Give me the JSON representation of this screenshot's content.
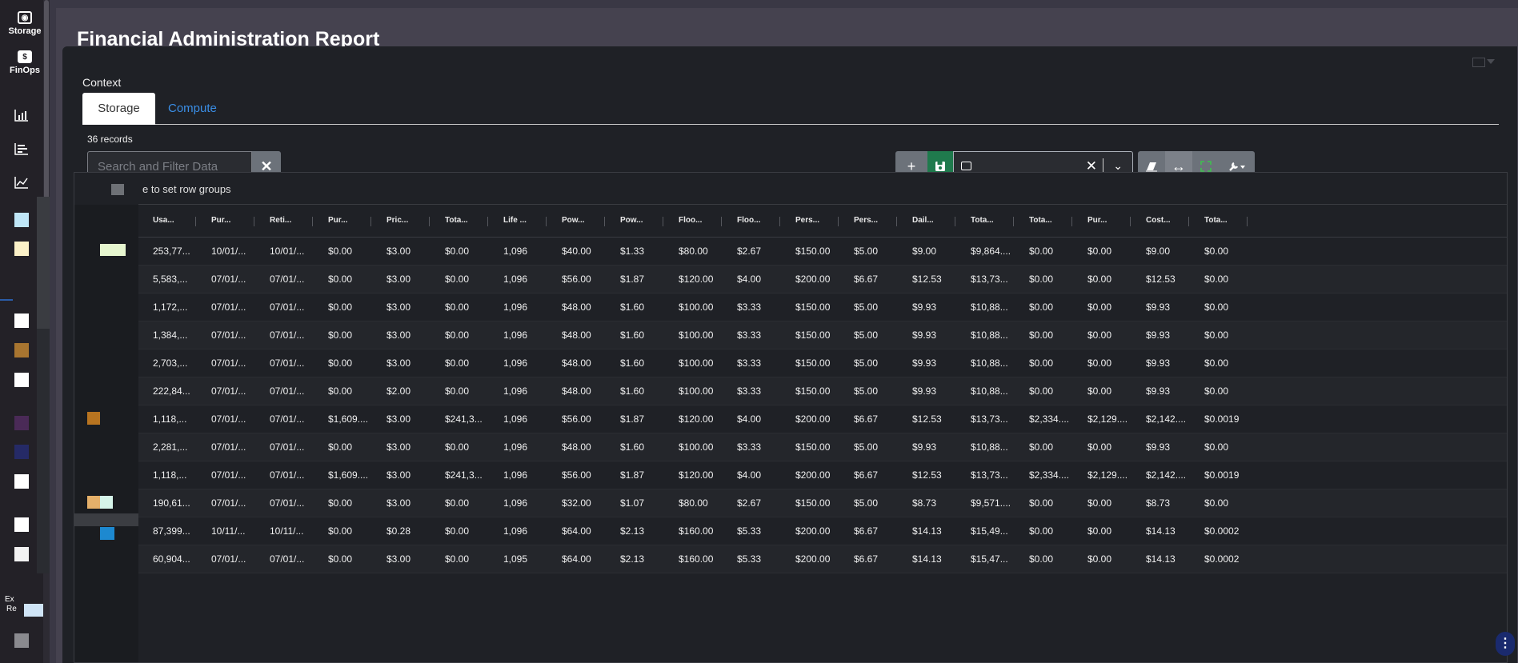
{
  "sidebar": {
    "items": [
      {
        "label": "Storage",
        "icon": "storage-icon"
      },
      {
        "label": "FinOps",
        "icon": "dollar-icon"
      }
    ],
    "bottom_label_1": "Ex",
    "bottom_label_2": "Re"
  },
  "page": {
    "title": "Financial Administration Report"
  },
  "context": {
    "label": "Context",
    "tabs": [
      "Storage",
      "Compute"
    ],
    "active_tab": "Storage"
  },
  "records": {
    "count_text": "36 records"
  },
  "search": {
    "placeholder": "Search and Filter Data",
    "clear": "✕"
  },
  "toolbar": {
    "add": "+",
    "save": "💾",
    "view_clear": "✕",
    "view_chevron": "⌄",
    "fit": "↔",
    "fullscreen": "⛶",
    "tools": "🔧▾"
  },
  "grid": {
    "group_hint": "e to set row groups",
    "columns": [
      "Usa...",
      "Pur...",
      "Reti...",
      "Pur...",
      "Pric...",
      "Tota...",
      "Life ...",
      "Pow...",
      "Pow...",
      "Floo...",
      "Floo...",
      "Pers...",
      "Pers...",
      "Dail...",
      "Tota...",
      "Tota...",
      "Pur...",
      "Cost...",
      "Tota..."
    ],
    "rows": [
      [
        "253,77...",
        "10/01/...",
        "10/01/...",
        "$0.00",
        "$3.00",
        "$0.00",
        "1,096",
        "$40.00",
        "$1.33",
        "$80.00",
        "$2.67",
        "$150.00",
        "$5.00",
        "$9.00",
        "$9,864....",
        "$0.00",
        "$0.00",
        "$9.00",
        "$0.00"
      ],
      [
        "5,583,...",
        "07/01/...",
        "07/01/...",
        "$0.00",
        "$3.00",
        "$0.00",
        "1,096",
        "$56.00",
        "$1.87",
        "$120.00",
        "$4.00",
        "$200.00",
        "$6.67",
        "$12.53",
        "$13,73...",
        "$0.00",
        "$0.00",
        "$12.53",
        "$0.00"
      ],
      [
        "1,172,...",
        "07/01/...",
        "07/01/...",
        "$0.00",
        "$3.00",
        "$0.00",
        "1,096",
        "$48.00",
        "$1.60",
        "$100.00",
        "$3.33",
        "$150.00",
        "$5.00",
        "$9.93",
        "$10,88...",
        "$0.00",
        "$0.00",
        "$9.93",
        "$0.00"
      ],
      [
        "1,384,...",
        "07/01/...",
        "07/01/...",
        "$0.00",
        "$3.00",
        "$0.00",
        "1,096",
        "$48.00",
        "$1.60",
        "$100.00",
        "$3.33",
        "$150.00",
        "$5.00",
        "$9.93",
        "$10,88...",
        "$0.00",
        "$0.00",
        "$9.93",
        "$0.00"
      ],
      [
        "2,703,...",
        "07/01/...",
        "07/01/...",
        "$0.00",
        "$3.00",
        "$0.00",
        "1,096",
        "$48.00",
        "$1.60",
        "$100.00",
        "$3.33",
        "$150.00",
        "$5.00",
        "$9.93",
        "$10,88...",
        "$0.00",
        "$0.00",
        "$9.93",
        "$0.00"
      ],
      [
        "222,84...",
        "07/01/...",
        "07/01/...",
        "$0.00",
        "$2.00",
        "$0.00",
        "1,096",
        "$48.00",
        "$1.60",
        "$100.00",
        "$3.33",
        "$150.00",
        "$5.00",
        "$9.93",
        "$10,88...",
        "$0.00",
        "$0.00",
        "$9.93",
        "$0.00"
      ],
      [
        "1,118,...",
        "07/01/...",
        "07/01/...",
        "$1,609....",
        "$3.00",
        "$241,3...",
        "1,096",
        "$56.00",
        "$1.87",
        "$120.00",
        "$4.00",
        "$200.00",
        "$6.67",
        "$12.53",
        "$13,73...",
        "$2,334....",
        "$2,129....",
        "$2,142....",
        "$0.0019"
      ],
      [
        "2,281,...",
        "07/01/...",
        "07/01/...",
        "$0.00",
        "$3.00",
        "$0.00",
        "1,096",
        "$48.00",
        "$1.60",
        "$100.00",
        "$3.33",
        "$150.00",
        "$5.00",
        "$9.93",
        "$10,88...",
        "$0.00",
        "$0.00",
        "$9.93",
        "$0.00"
      ],
      [
        "1,118,...",
        "07/01/...",
        "07/01/...",
        "$1,609....",
        "$3.00",
        "$241,3...",
        "1,096",
        "$56.00",
        "$1.87",
        "$120.00",
        "$4.00",
        "$200.00",
        "$6.67",
        "$12.53",
        "$13,73...",
        "$2,334....",
        "$2,129....",
        "$2,142....",
        "$0.0019"
      ],
      [
        "190,61...",
        "07/01/...",
        "07/01/...",
        "$0.00",
        "$3.00",
        "$0.00",
        "1,096",
        "$32.00",
        "$1.07",
        "$80.00",
        "$2.67",
        "$150.00",
        "$5.00",
        "$8.73",
        "$9,571....",
        "$0.00",
        "$0.00",
        "$8.73",
        "$0.00"
      ],
      [
        "87,399...",
        "10/11/...",
        "10/11/...",
        "$0.00",
        "$0.28",
        "$0.00",
        "1,096",
        "$64.00",
        "$2.13",
        "$160.00",
        "$5.33",
        "$200.00",
        "$6.67",
        "$14.13",
        "$15,49...",
        "$0.00",
        "$0.00",
        "$14.13",
        "$0.0002"
      ],
      [
        "60,904...",
        "07/01/...",
        "07/01/...",
        "$0.00",
        "$3.00",
        "$0.00",
        "1,095",
        "$64.00",
        "$2.13",
        "$160.00",
        "$5.33",
        "$200.00",
        "$6.67",
        "$14.13",
        "$15,47...",
        "$0.00",
        "$0.00",
        "$14.13",
        "$0.0002"
      ]
    ]
  },
  "help": {
    "label": "⋮"
  },
  "colors": {
    "accent_blue": "#3a8ee6",
    "save_green": "#1f7a4d",
    "panel_bg": "#45424f",
    "grid_bg": "#1f2126"
  }
}
